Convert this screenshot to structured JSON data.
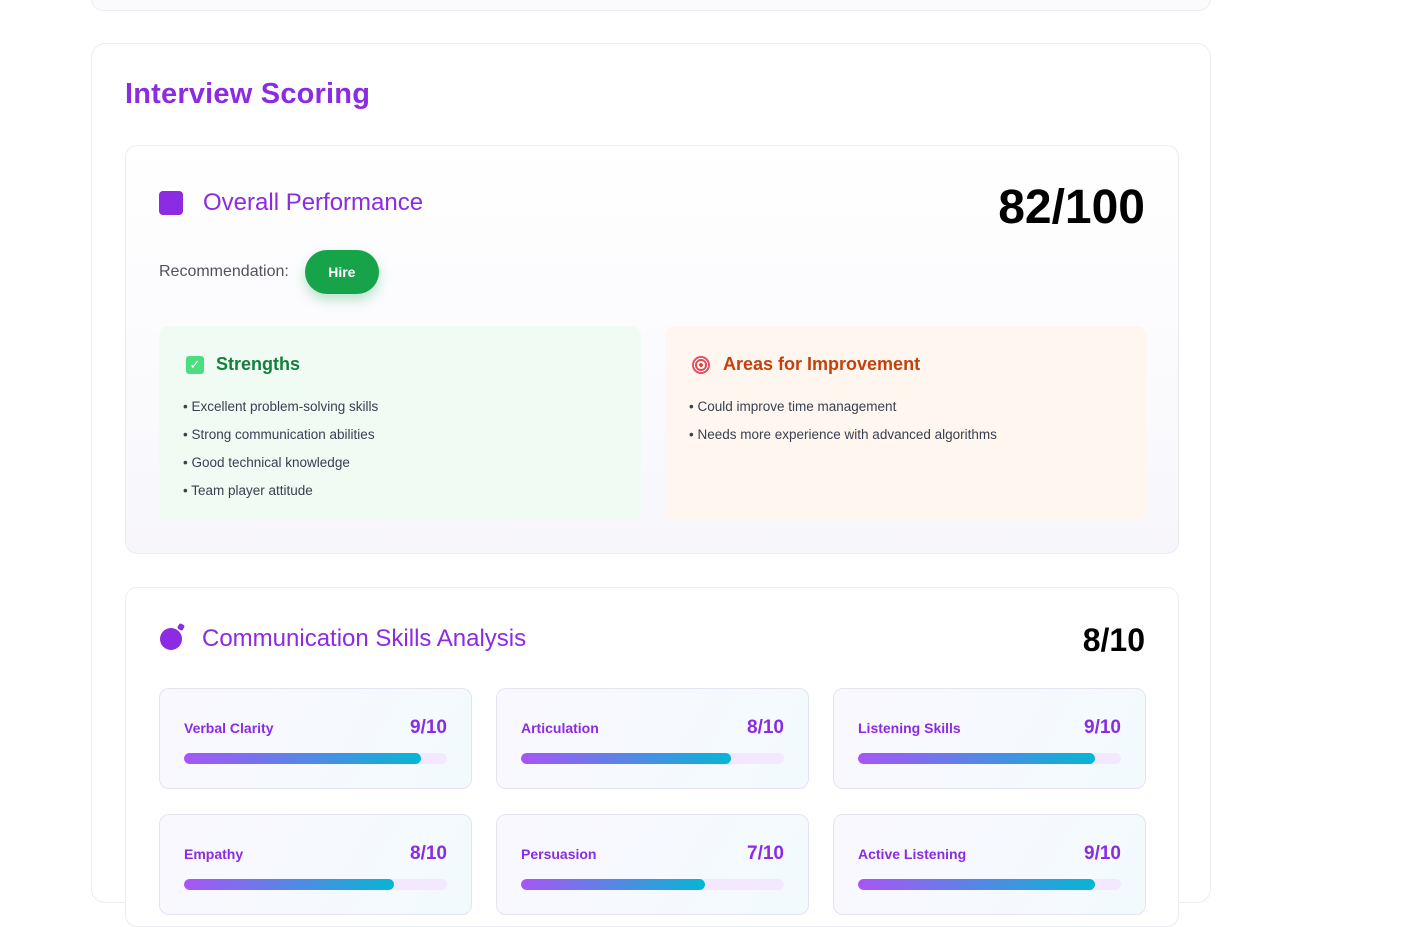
{
  "scoring": {
    "title": "Interview Scoring",
    "overall": {
      "title": "Overall Performance",
      "icon": "purple-square-icon",
      "score": "82/100",
      "recommendation_label": "Recommendation:",
      "recommendation": "Hire",
      "strengths": {
        "title": "Strengths",
        "icon": "check-icon",
        "items": [
          "• Excellent problem-solving skills",
          "• Strong communication abilities",
          "• Good technical knowledge",
          "• Team player attitude"
        ]
      },
      "improvements": {
        "title": "Areas for Improvement",
        "icon": "target-icon",
        "items": [
          "• Could improve time management",
          "• Needs more experience with advanced algorithms"
        ]
      }
    },
    "communication": {
      "title": "Communication Skills Analysis",
      "icon": "bomb-icon",
      "score": "8/10",
      "skills": [
        {
          "name": "Verbal Clarity",
          "score": "9/10",
          "fraction": 0.9
        },
        {
          "name": "Articulation",
          "score": "8/10",
          "fraction": 0.8
        },
        {
          "name": "Listening Skills",
          "score": "9/10",
          "fraction": 0.9
        },
        {
          "name": "Empathy",
          "score": "8/10",
          "fraction": 0.8
        },
        {
          "name": "Persuasion",
          "score": "7/10",
          "fraction": 0.7
        },
        {
          "name": "Active Listening",
          "score": "9/10",
          "fraction": 0.9
        }
      ]
    }
  },
  "colors": {
    "accent": "#8b2be2",
    "success": "#16a34a",
    "strength_text": "#15803d",
    "improve_text": "#c2410c"
  }
}
